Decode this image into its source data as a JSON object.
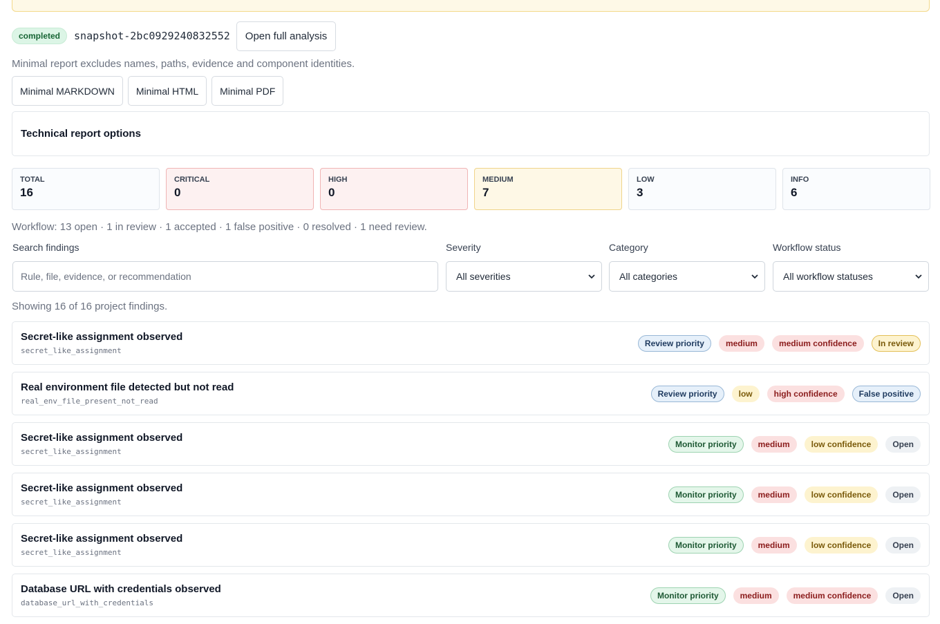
{
  "snapshot": {
    "status": "completed",
    "id": "snapshot-2bc0929240832552",
    "open_button": "Open full analysis"
  },
  "minimal": {
    "note": "Minimal report excludes names, paths, evidence and component identities.",
    "buttons": [
      "Minimal MARKDOWN",
      "Minimal HTML",
      "Minimal PDF"
    ]
  },
  "technical": {
    "title": "Technical report options"
  },
  "stats": [
    {
      "label": "TOTAL",
      "value": "16"
    },
    {
      "label": "CRITICAL",
      "value": "0"
    },
    {
      "label": "HIGH",
      "value": "0"
    },
    {
      "label": "MEDIUM",
      "value": "7"
    },
    {
      "label": "LOW",
      "value": "3"
    },
    {
      "label": "INFO",
      "value": "6"
    }
  ],
  "workflow_summary": "Workflow: 13 open · 1 in review · 1 accepted · 1 false positive · 0 resolved · 1 need review.",
  "filters": {
    "search_label": "Search findings",
    "search_placeholder": "Rule, file, evidence, or recommendation",
    "severity_label": "Severity",
    "severity_value": "All severities",
    "category_label": "Category",
    "category_value": "All categories",
    "workflow_label": "Workflow status",
    "workflow_value": "All workflow statuses"
  },
  "showing": "Showing 16 of 16 project findings.",
  "findings": [
    {
      "title": "Secret-like assignment observed",
      "rule": "secret_like_assignment",
      "priority": "Review priority",
      "severity": "medium",
      "confidence": "medium confidence",
      "status": "In review"
    },
    {
      "title": "Real environment file detected but not read",
      "rule": "real_env_file_present_not_read",
      "priority": "Review priority",
      "severity": "low",
      "confidence": "high confidence",
      "status": "False positive"
    },
    {
      "title": "Secret-like assignment observed",
      "rule": "secret_like_assignment",
      "priority": "Monitor priority",
      "severity": "medium",
      "confidence": "low confidence",
      "status": "Open"
    },
    {
      "title": "Secret-like assignment observed",
      "rule": "secret_like_assignment",
      "priority": "Monitor priority",
      "severity": "medium",
      "confidence": "low confidence",
      "status": "Open"
    },
    {
      "title": "Secret-like assignment observed",
      "rule": "secret_like_assignment",
      "priority": "Monitor priority",
      "severity": "medium",
      "confidence": "low confidence",
      "status": "Open"
    },
    {
      "title": "Database URL with credentials observed",
      "rule": "database_url_with_credentials",
      "priority": "Monitor priority",
      "severity": "medium",
      "confidence": "medium confidence",
      "status": "Open"
    }
  ]
}
